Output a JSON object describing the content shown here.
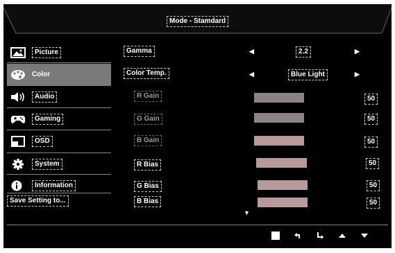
{
  "header": {
    "title": "Mode - Stamdard"
  },
  "sidebar": {
    "items": [
      {
        "label": "Picture",
        "icon": "picture-icon",
        "selected": false
      },
      {
        "label": "Color",
        "icon": "palette-icon",
        "selected": true
      },
      {
        "label": "Audio",
        "icon": "speaker-icon",
        "selected": false
      },
      {
        "label": "Gaming",
        "icon": "gamepad-icon",
        "selected": false
      },
      {
        "label": "OSD",
        "icon": "osd-window-icon",
        "selected": false
      },
      {
        "label": "System",
        "icon": "gear-icon",
        "selected": false
      },
      {
        "label": "Information",
        "icon": "info-icon",
        "selected": false
      }
    ],
    "save_label": "Save Setting to..."
  },
  "settings": {
    "gamma": {
      "label": "Gamma",
      "value": "2.2"
    },
    "color_temp": {
      "label": "Color Temp.",
      "value": "Blue Light"
    },
    "sliders": [
      {
        "label": "R Gain",
        "value": "50",
        "level": 0.5,
        "enabled": false
      },
      {
        "label": "G Gain",
        "value": "50",
        "level": 0.5,
        "enabled": false
      },
      {
        "label": "B Gain",
        "value": "50",
        "level": 0.5,
        "enabled": false
      },
      {
        "label": "R Bias",
        "value": "50",
        "level": 0.5,
        "enabled": true
      },
      {
        "label": "G Bias",
        "value": "50",
        "level": 0.5,
        "enabled": true
      },
      {
        "label": "B Bias",
        "value": "50",
        "level": 0.5,
        "enabled": true
      }
    ]
  },
  "footer": {
    "buttons": [
      "power-icon",
      "back-icon",
      "enter-icon",
      "up-arrow-icon",
      "down-arrow-icon"
    ]
  },
  "colors": {
    "background": "#000000",
    "selected": "#7a7a7a",
    "fill_gain": "#8c8484",
    "fill_bias": "#b89a9a",
    "text": "#ffffff"
  }
}
